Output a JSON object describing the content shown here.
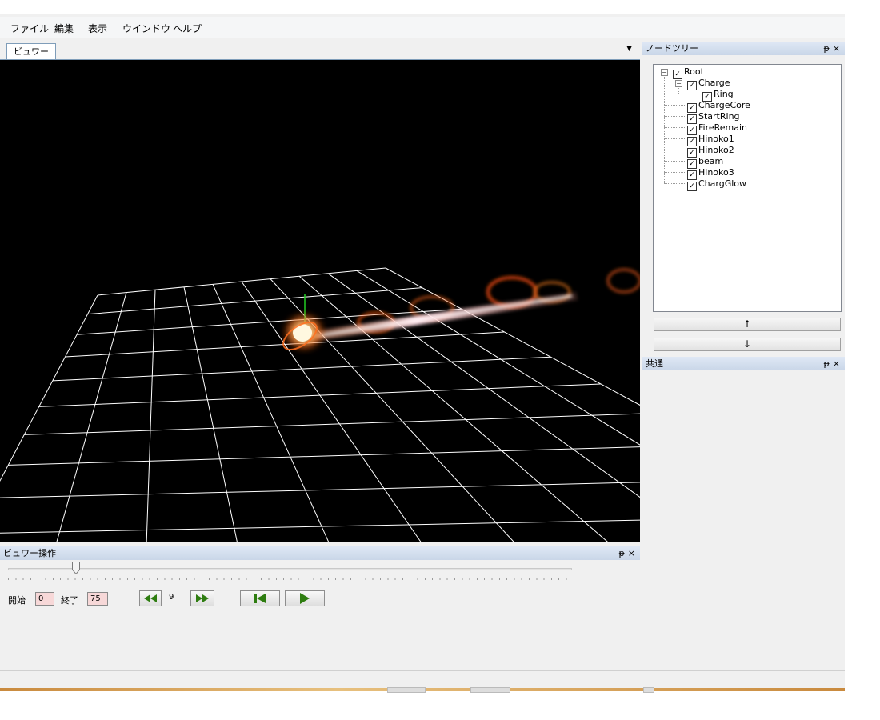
{
  "menu": {
    "items": [
      "ファイル",
      "編集",
      "表示",
      "ウインドウ",
      "ヘルプ"
    ]
  },
  "viewer": {
    "tab_label": "ビュワー",
    "dropdown_icon": "chevron-down-icon"
  },
  "node_tree": {
    "title": "ノードツリー",
    "pin_icon": "pin-icon",
    "close_icon": "close-icon",
    "nodes": [
      "Root",
      "Charge",
      "Ring",
      "ChargeCore",
      "StartRing",
      "FireRemain",
      "Hinoko1",
      "Hinoko2",
      "beam",
      "Hinoko3",
      "ChargGlow"
    ],
    "up_label": "↑",
    "down_label": "↓"
  },
  "common_panel": {
    "title": "共通"
  },
  "viewer_control": {
    "title": "ビュワー操作",
    "start_label": "開始",
    "start_value": "0",
    "end_label": "終了",
    "end_value": "75",
    "current_frame": "9",
    "slider_fraction": 0.12,
    "colors": {
      "button_icon": "#2e7d10",
      "input_bg": "#f7d8d8"
    }
  }
}
